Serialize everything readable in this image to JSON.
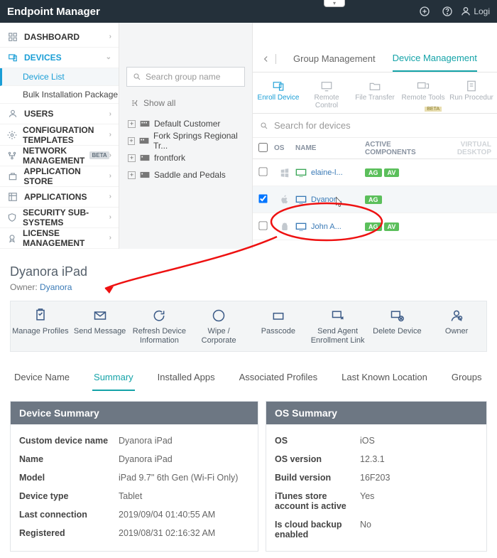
{
  "app": {
    "title": "Endpoint Manager",
    "breadcrumb": "Device List",
    "login_label": "Logi"
  },
  "sidebar": {
    "items": [
      {
        "label": "DASHBOARD"
      },
      {
        "label": "DEVICES"
      },
      {
        "label": "USERS"
      },
      {
        "label": "CONFIGURATION TEMPLATES"
      },
      {
        "label": "NETWORK MANAGEMENT",
        "badge": "BETA"
      },
      {
        "label": "APPLICATION STORE"
      },
      {
        "label": "APPLICATIONS"
      },
      {
        "label": "SECURITY SUB-SYSTEMS"
      },
      {
        "label": "LICENSE MANAGEMENT"
      }
    ],
    "devices_sub": [
      {
        "label": "Device List"
      },
      {
        "label": "Bulk Installation Package"
      }
    ]
  },
  "tree": {
    "search_placeholder": "Search group name",
    "show_all": "Show all",
    "items": [
      {
        "label": "Default Customer"
      },
      {
        "label": "Fork Springs Regional Tr..."
      },
      {
        "label": "frontfork"
      },
      {
        "label": "Saddle and Pedals"
      }
    ]
  },
  "device_tabs": {
    "group_mgmt": "Group Management",
    "device_mgmt": "Device Management"
  },
  "device_actions": [
    {
      "label": "Enroll Device",
      "on": true
    },
    {
      "label": "Remote Control"
    },
    {
      "label": "File Transfer"
    },
    {
      "label": "Remote Tools",
      "beta": "BETA"
    },
    {
      "label": "Run Procedur"
    }
  ],
  "device_search_placeholder": "Search for devices",
  "device_columns": {
    "os": "OS",
    "name": "NAME",
    "active": "ACTIVE COMPONENTS",
    "virtual": "VIRTUAL DESKTOP"
  },
  "device_rows": [
    {
      "os": "windows",
      "name": "elaine-l...",
      "color": "green",
      "pills": [
        "AG",
        "AV"
      ],
      "checked": false
    },
    {
      "os": "apple",
      "name": "Dyanor...",
      "color": "blue",
      "pills": [
        "AG"
      ],
      "checked": true
    },
    {
      "os": "android",
      "name": "John A...",
      "color": "blue",
      "pills": [
        "AG",
        "AV"
      ],
      "checked": false
    }
  ],
  "detail": {
    "title": "Dyanora iPad",
    "owner_label": "Owner:",
    "owner_name": "Dyanora"
  },
  "detail_actions": [
    {
      "label": "Manage Profiles"
    },
    {
      "label": "Send Message"
    },
    {
      "label": "Refresh Device Information"
    },
    {
      "label": "Wipe / Corporate"
    },
    {
      "label": "Passcode"
    },
    {
      "label": "Send Agent Enrollment Link"
    },
    {
      "label": "Delete Device"
    },
    {
      "label": "Owner"
    }
  ],
  "detail_tabs": [
    "Device Name",
    "Summary",
    "Installed Apps",
    "Associated Profiles",
    "Last Known Location",
    "Groups"
  ],
  "device_summary": {
    "title": "Device Summary",
    "rows": [
      {
        "k": "Custom device name",
        "v": "Dyanora iPad"
      },
      {
        "k": "Name",
        "v": "Dyanora iPad"
      },
      {
        "k": "Model",
        "v": "iPad 9.7\" 6th Gen (Wi-Fi Only)"
      },
      {
        "k": "Device type",
        "v": "Tablet"
      },
      {
        "k": "Last connection",
        "v": "2019/09/04 01:40:55 AM"
      },
      {
        "k": "Registered",
        "v": "2019/08/31 02:16:32 AM"
      }
    ]
  },
  "os_summary": {
    "title": "OS Summary",
    "rows": [
      {
        "k": "OS",
        "v": "iOS"
      },
      {
        "k": "OS version",
        "v": "12.3.1"
      },
      {
        "k": "Build version",
        "v": "16F203"
      },
      {
        "k": "iTunes store account is active",
        "v": "Yes"
      },
      {
        "k": "Is cloud backup enabled",
        "v": "No"
      }
    ]
  }
}
